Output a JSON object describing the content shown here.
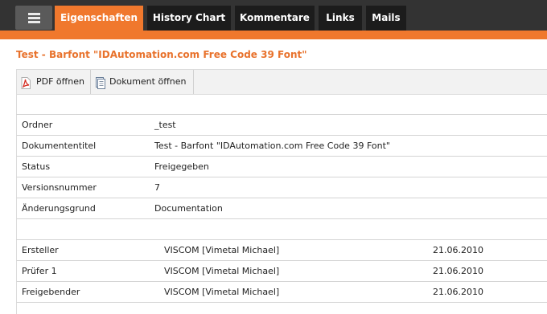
{
  "nav": {
    "tabs": [
      {
        "label": "Eigenschaften",
        "active": true
      },
      {
        "label": "History Chart",
        "active": false
      },
      {
        "label": "Kommentare",
        "active": false
      },
      {
        "label": "Links",
        "active": false
      },
      {
        "label": "Mails",
        "active": false
      }
    ],
    "menu_icon": "hamburger-menu-icon"
  },
  "document": {
    "title": "Test - Barfont \"IDAutomation.com Free Code 39 Font\""
  },
  "toolbar": {
    "pdf_label": "PDF öffnen",
    "pdf_icon": "pdf-icon",
    "doc_label": "Dokument öffnen",
    "doc_icon": "document-icon"
  },
  "properties": [
    {
      "label": "Ordner",
      "value": "_test"
    },
    {
      "label": "Dokumententitel",
      "value": "Test - Barfont \"IDAutomation.com Free Code 39 Font\""
    },
    {
      "label": "Status",
      "value": "Freigegeben"
    },
    {
      "label": "Versionsnummer",
      "value": "7"
    },
    {
      "label": "Änderungsgrund",
      "value": "Documentation"
    }
  ],
  "signatures": [
    {
      "role": "Ersteller",
      "person": "VISCOM [Vimetal Michael]",
      "date": "21.06.2010"
    },
    {
      "role": "Prüfer 1",
      "person": "VISCOM [Vimetal Michael]",
      "date": "21.06.2010"
    },
    {
      "role": "Freigebender",
      "person": "VISCOM [Vimetal Michael]",
      "date": "21.06.2010"
    }
  ],
  "colors": {
    "accent": "#f0782d",
    "topbar": "#333333",
    "tab_bg": "#1c1c1c",
    "title": "#e8722c"
  }
}
